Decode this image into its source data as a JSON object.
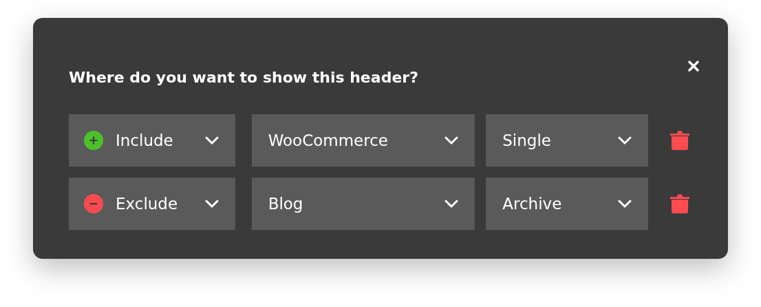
{
  "dialog": {
    "title": "Where do you want to show this header?"
  },
  "rules": [
    {
      "mode": {
        "kind": "include",
        "label": "Include"
      },
      "source": "WooCommerce",
      "scope": "Single"
    },
    {
      "mode": {
        "kind": "exclude",
        "label": "Exclude"
      },
      "source": "Blog",
      "scope": "Archive"
    }
  ]
}
